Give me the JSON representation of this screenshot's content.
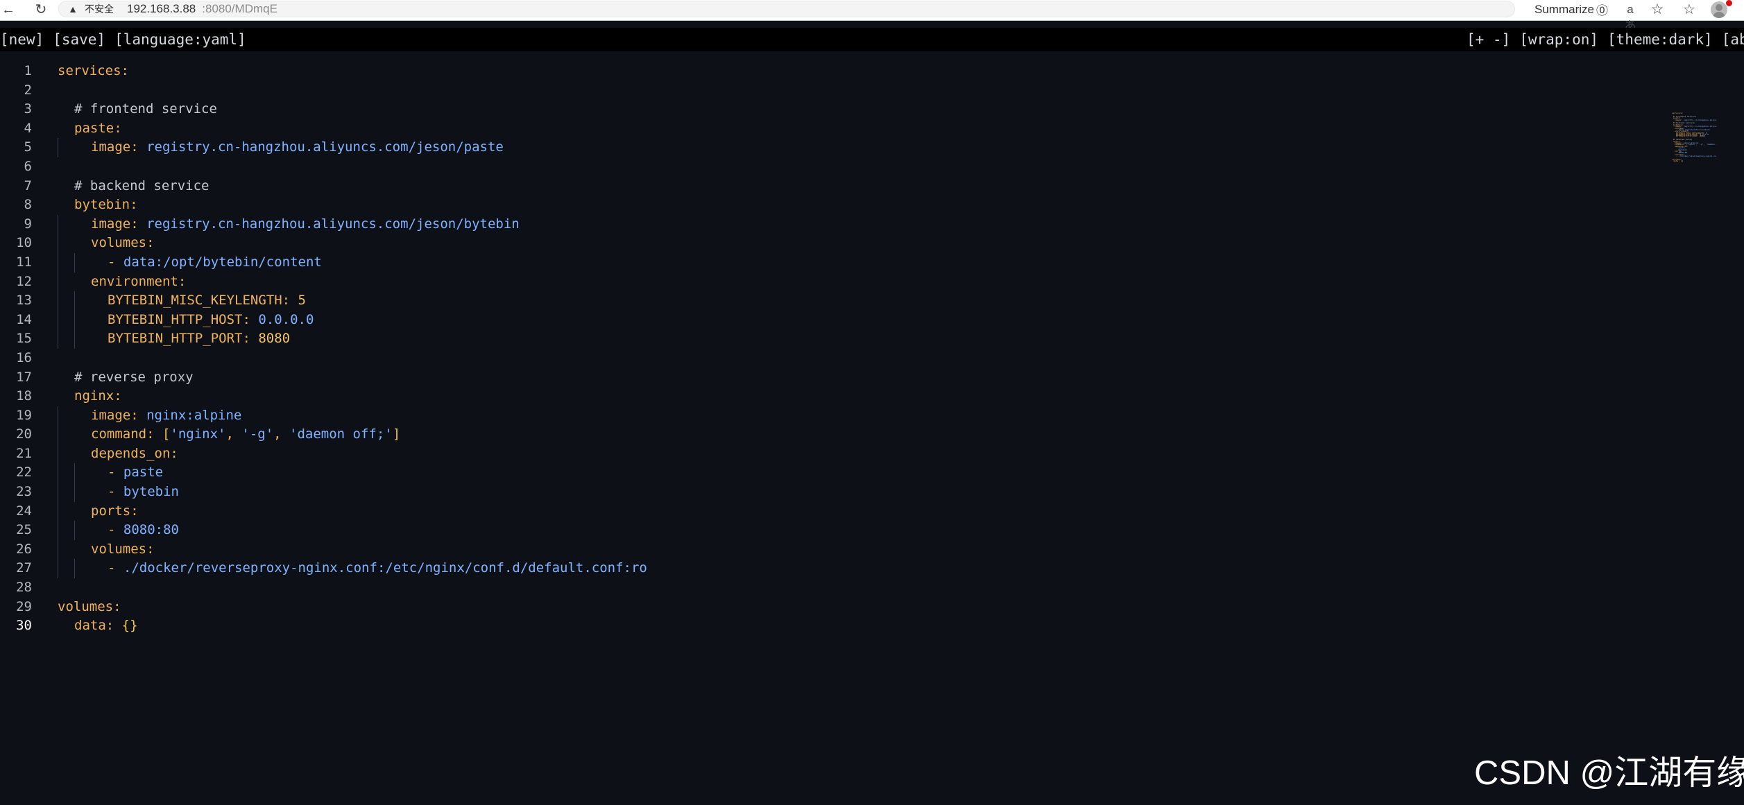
{
  "browser": {
    "security_label": "不安全",
    "url_host": "192.168.3.88",
    "url_rest": ":8080/MDmqE",
    "summarize_label": "Summarize",
    "read_aloud_label": "aあ"
  },
  "menu": {
    "left": [
      "[new]",
      "[save]",
      "[language:yaml]"
    ],
    "right": [
      "[+ -]",
      "[wrap:on]",
      "[theme:dark]",
      "[abou"
    ]
  },
  "editor": {
    "active_line": 30,
    "lines": [
      {
        "number": "1",
        "indent": 0,
        "segments": [
          {
            "class": "key top",
            "text": "services:"
          }
        ]
      },
      {
        "number": "2",
        "indent": 0,
        "segments": []
      },
      {
        "number": "3",
        "indent": 1,
        "segments": [
          {
            "class": "comment",
            "text": "# frontend service"
          }
        ]
      },
      {
        "number": "4",
        "indent": 1,
        "segments": [
          {
            "class": "key",
            "text": "paste:"
          }
        ]
      },
      {
        "number": "5",
        "indent": 2,
        "segments": [
          {
            "class": "key",
            "text": "image: "
          },
          {
            "class": "str",
            "text": "registry.cn-hangzhou.aliyuncs.com/jeson/paste"
          }
        ]
      },
      {
        "number": "6",
        "indent": 0,
        "segments": []
      },
      {
        "number": "7",
        "indent": 1,
        "segments": [
          {
            "class": "comment",
            "text": "# backend service"
          }
        ]
      },
      {
        "number": "8",
        "indent": 1,
        "segments": [
          {
            "class": "key",
            "text": "bytebin:"
          }
        ]
      },
      {
        "number": "9",
        "indent": 2,
        "segments": [
          {
            "class": "key",
            "text": "image: "
          },
          {
            "class": "str",
            "text": "registry.cn-hangzhou.aliyuncs.com/jeson/bytebin"
          }
        ]
      },
      {
        "number": "10",
        "indent": 2,
        "segments": [
          {
            "class": "key",
            "text": "volumes:"
          }
        ]
      },
      {
        "number": "11",
        "indent": 3,
        "segments": [
          {
            "class": "sym",
            "text": "- "
          },
          {
            "class": "str",
            "text": "data:/opt/bytebin/content"
          }
        ]
      },
      {
        "number": "12",
        "indent": 2,
        "segments": [
          {
            "class": "key",
            "text": "environment:"
          }
        ]
      },
      {
        "number": "13",
        "indent": 3,
        "segments": [
          {
            "class": "key",
            "text": "BYTEBIN_MISC_KEYLENGTH: "
          },
          {
            "class": "num",
            "text": "5"
          }
        ]
      },
      {
        "number": "14",
        "indent": 3,
        "segments": [
          {
            "class": "key",
            "text": "BYTEBIN_HTTP_HOST: "
          },
          {
            "class": "str",
            "text": "0.0.0.0"
          }
        ]
      },
      {
        "number": "15",
        "indent": 3,
        "segments": [
          {
            "class": "key",
            "text": "BYTEBIN_HTTP_PORT: "
          },
          {
            "class": "num",
            "text": "8080"
          }
        ]
      },
      {
        "number": "16",
        "indent": 0,
        "segments": []
      },
      {
        "number": "17",
        "indent": 1,
        "segments": [
          {
            "class": "comment",
            "text": "# reverse proxy"
          }
        ]
      },
      {
        "number": "18",
        "indent": 1,
        "segments": [
          {
            "class": "key",
            "text": "nginx:"
          }
        ]
      },
      {
        "number": "19",
        "indent": 2,
        "segments": [
          {
            "class": "key",
            "text": "image: "
          },
          {
            "class": "str",
            "text": "nginx:alpine"
          }
        ]
      },
      {
        "number": "20",
        "indent": 2,
        "segments": [
          {
            "class": "key",
            "text": "command: "
          },
          {
            "class": "bracket",
            "text": "["
          },
          {
            "class": "quote",
            "text": "'nginx'"
          },
          {
            "class": "sym",
            "text": ", "
          },
          {
            "class": "quote",
            "text": "'-g'"
          },
          {
            "class": "sym",
            "text": ", "
          },
          {
            "class": "quote",
            "text": "'daemon off;'"
          },
          {
            "class": "bracket",
            "text": "]"
          }
        ]
      },
      {
        "number": "21",
        "indent": 2,
        "segments": [
          {
            "class": "key",
            "text": "depends_on:"
          }
        ]
      },
      {
        "number": "22",
        "indent": 3,
        "segments": [
          {
            "class": "sym",
            "text": "- "
          },
          {
            "class": "str",
            "text": "paste"
          }
        ]
      },
      {
        "number": "23",
        "indent": 3,
        "segments": [
          {
            "class": "sym",
            "text": "- "
          },
          {
            "class": "str",
            "text": "bytebin"
          }
        ]
      },
      {
        "number": "24",
        "indent": 2,
        "segments": [
          {
            "class": "key",
            "text": "ports:"
          }
        ]
      },
      {
        "number": "25",
        "indent": 3,
        "segments": [
          {
            "class": "sym",
            "text": "- "
          },
          {
            "class": "str",
            "text": "8080:80"
          }
        ]
      },
      {
        "number": "26",
        "indent": 2,
        "segments": [
          {
            "class": "key",
            "text": "volumes:"
          }
        ]
      },
      {
        "number": "27",
        "indent": 3,
        "segments": [
          {
            "class": "sym",
            "text": "- "
          },
          {
            "class": "str",
            "text": "./docker/reverseproxy-nginx.conf:/etc/nginx/conf.d/default.conf:ro"
          }
        ]
      },
      {
        "number": "28",
        "indent": 0,
        "segments": []
      },
      {
        "number": "29",
        "indent": 0,
        "segments": [
          {
            "class": "key top",
            "text": "volumes:"
          }
        ]
      },
      {
        "number": "30",
        "indent": 1,
        "segments": [
          {
            "class": "key",
            "text": "data: "
          },
          {
            "class": "bracket",
            "text": "{}"
          }
        ]
      }
    ]
  },
  "watermark": {
    "text": "CSDN @江湖有缘"
  },
  "colors": {
    "editor_background": "#0d1117",
    "menu_background": "#000000",
    "key": "#f0b35d",
    "string": "#7fb2ff",
    "number": "#f5c36a",
    "comment": "#c5c8cf",
    "line_number": "#b4b7be"
  },
  "icons": {
    "back": "back-arrow-icon",
    "reload": "reload-icon",
    "security": "warning-icon",
    "summarize": "summarize-icon",
    "read_aloud": "read-aloud-icon",
    "favorite": "star-icon",
    "favorites_bar": "favorites-bar-icon",
    "profile": "profile-avatar"
  }
}
